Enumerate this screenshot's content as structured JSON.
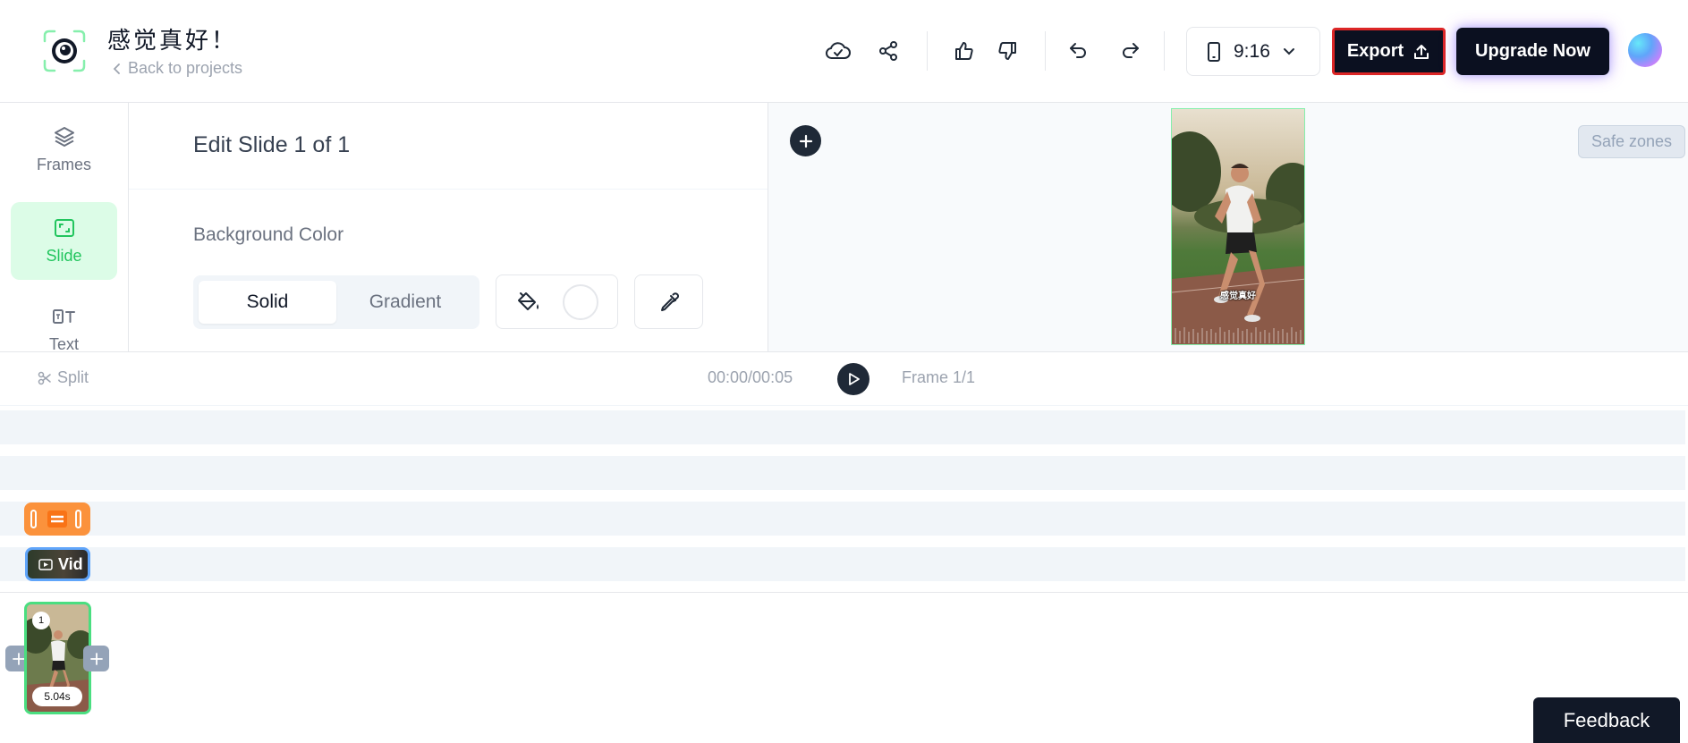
{
  "header": {
    "project_title": "感觉真好！",
    "back_label": "Back to projects",
    "aspect_ratio": "9:16",
    "export_label": "Export",
    "upgrade_label": "Upgrade Now",
    "icons": [
      "cloud-check-icon",
      "share-icon",
      "thumbs-up-icon",
      "thumbs-down-icon",
      "undo-icon",
      "redo-icon",
      "phone-icon",
      "chevron-down-icon",
      "upload-icon"
    ]
  },
  "sidebar": {
    "items": [
      {
        "label": "Frames",
        "icon": "layers-icon",
        "active": false
      },
      {
        "label": "Slide",
        "icon": "slide-icon",
        "active": true
      },
      {
        "label": "Text",
        "icon": "text-icon",
        "active": false
      }
    ]
  },
  "editor": {
    "title": "Edit Slide 1 of 1",
    "background_color_label": "Background Color",
    "fill_modes": [
      "Solid",
      "Gradient"
    ],
    "selected_fill_mode": "Solid",
    "swatch_color": "#ffffff"
  },
  "canvas": {
    "safe_zones_label": "Safe zones",
    "caption": "感觉真好"
  },
  "timeline": {
    "split_label": "Split",
    "timecode": "00:00/00:05",
    "frame_label": "Frame 1/1",
    "video_clip_label": "Vid",
    "frames": [
      {
        "number": "1",
        "duration": "5.04s"
      }
    ]
  },
  "feedback_label": "Feedback",
  "colors": {
    "accent_green": "#22c55e",
    "dark": "#0b1020",
    "text_clip": "#fb923c",
    "video_clip_border": "#60a5fa",
    "export_border": "#dc2626"
  }
}
